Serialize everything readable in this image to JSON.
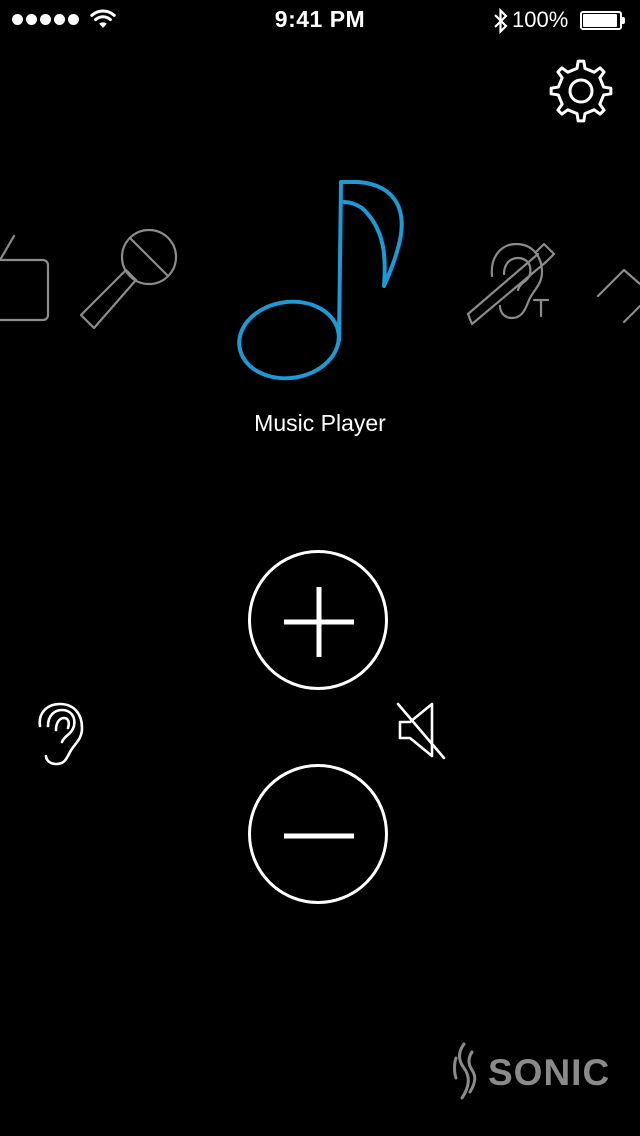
{
  "status_bar": {
    "signal_bars": 5,
    "time": "9:41 PM",
    "battery_percent": "100%",
    "icons": [
      "signal-dots",
      "wifi-icon",
      "bluetooth-icon",
      "battery-icon"
    ]
  },
  "header": {
    "settings_icon": "gear-icon"
  },
  "carousel": {
    "programs": [
      {
        "id": "tv",
        "icon": "tv-icon",
        "active": false
      },
      {
        "id": "microphone",
        "icon": "microphone-icon",
        "active": false
      },
      {
        "id": "music",
        "icon": "music-note-icon",
        "active": true
      },
      {
        "id": "telecoil",
        "icon": "telecoil-ear-icon",
        "active": false
      },
      {
        "id": "next",
        "icon": "partial-icon",
        "active": false
      }
    ],
    "active_label": "Music Player",
    "active_color": "#1a9ad6",
    "inactive_color": "#8c8c8c"
  },
  "volume": {
    "up_icon": "plus-icon",
    "down_icon": "minus-icon",
    "ear_icon": "ear-icon",
    "mute_icon": "speaker-mute-icon"
  },
  "brand": {
    "name": "SONIC",
    "color": "#8a8a8a"
  }
}
